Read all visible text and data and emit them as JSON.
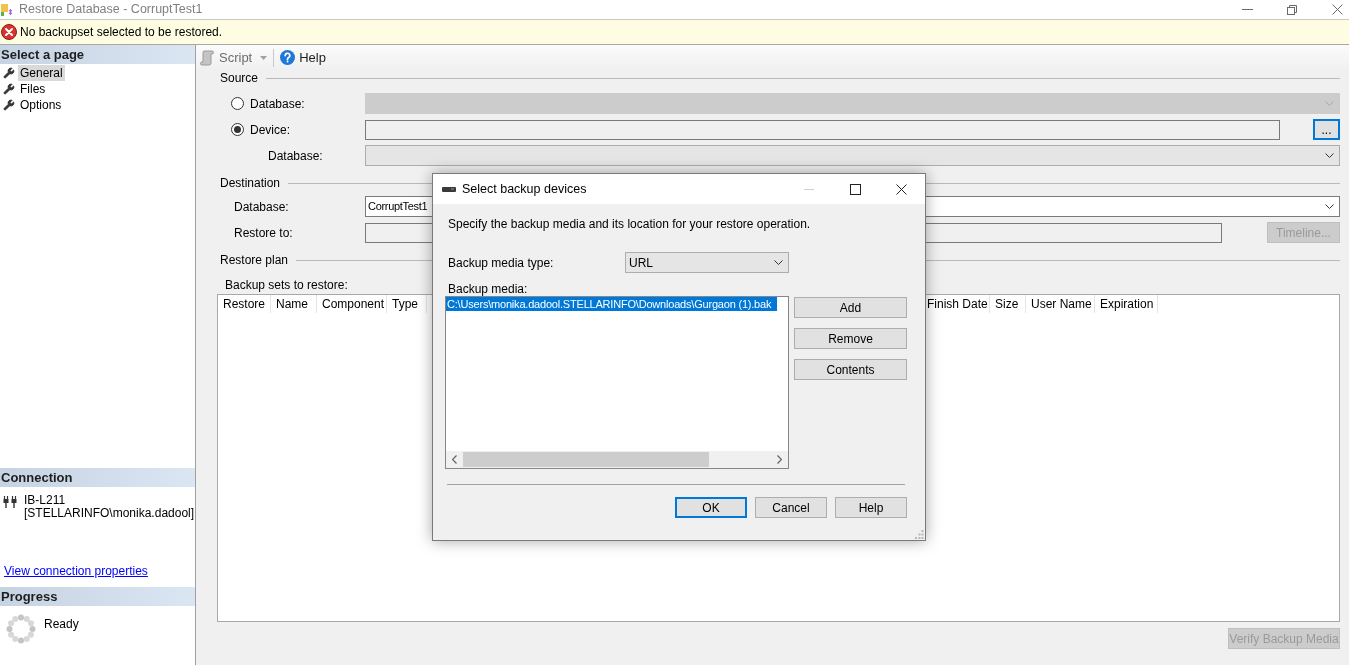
{
  "window": {
    "title": "Restore Database - CorruptTest1"
  },
  "error_bar": {
    "message": "No backupset selected to be restored."
  },
  "sidebar": {
    "header": "Select a page",
    "items": [
      {
        "label": "General",
        "selected": true
      },
      {
        "label": "Files",
        "selected": false
      },
      {
        "label": "Options",
        "selected": false
      }
    ],
    "connection": {
      "header": "Connection",
      "server": "IB-L211",
      "login": "[STELLARINFO\\monika.dadool]",
      "link": "View connection properties"
    },
    "progress": {
      "header": "Progress",
      "status": "Ready"
    }
  },
  "toolbar": [
    {
      "kind": "script",
      "label": "Script",
      "disabled": true
    },
    {
      "kind": "help",
      "label": "Help",
      "disabled": false
    }
  ],
  "source": {
    "title": "Source",
    "rows": [
      {
        "kind": "radio-combo",
        "label": "Database:",
        "selected": false,
        "disabled": true
      },
      {
        "kind": "radio-field",
        "label": "Device:",
        "selected": true,
        "button": {
          "label": "...",
          "disabled": false,
          "focused": true
        }
      },
      {
        "kind": "combo",
        "label": "Database:",
        "disabled": false
      }
    ]
  },
  "destination": {
    "title": "Destination",
    "rows": [
      {
        "kind": "combo",
        "label": "Database:",
        "value": "CorruptTest1",
        "disabled": false
      },
      {
        "kind": "field",
        "label": "Restore to:",
        "button": {
          "label": "Timeline...",
          "disabled": true
        }
      }
    ]
  },
  "restore_plan": {
    "title": "Restore plan",
    "table_label": "Backup sets to restore:",
    "columns": [
      "Restore",
      "Name",
      "Component",
      "Type",
      "Finish Date",
      "Size",
      "User Name",
      "Expiration"
    ],
    "verify_button": {
      "label": "Verify Backup Media",
      "disabled": true
    }
  },
  "dialog": {
    "title": "Select backup devices",
    "minimize": {
      "disabled": true
    },
    "description": "Specify the backup media and its location for your restore operation.",
    "media_type": {
      "label": "Backup media type:",
      "value": "URL"
    },
    "media_list": {
      "label": "Backup media:",
      "items": [
        {
          "text": "C:\\Users\\monika.dadool.STELLARINFO\\Downloads\\Gurgaon (1).bak",
          "selected": true
        }
      ]
    },
    "side_buttons": [
      "Add",
      "Remove",
      "Contents"
    ],
    "buttons": [
      {
        "label": "OK",
        "default": true
      },
      {
        "label": "Cancel",
        "default": false
      },
      {
        "label": "Help",
        "default": false
      }
    ]
  }
}
